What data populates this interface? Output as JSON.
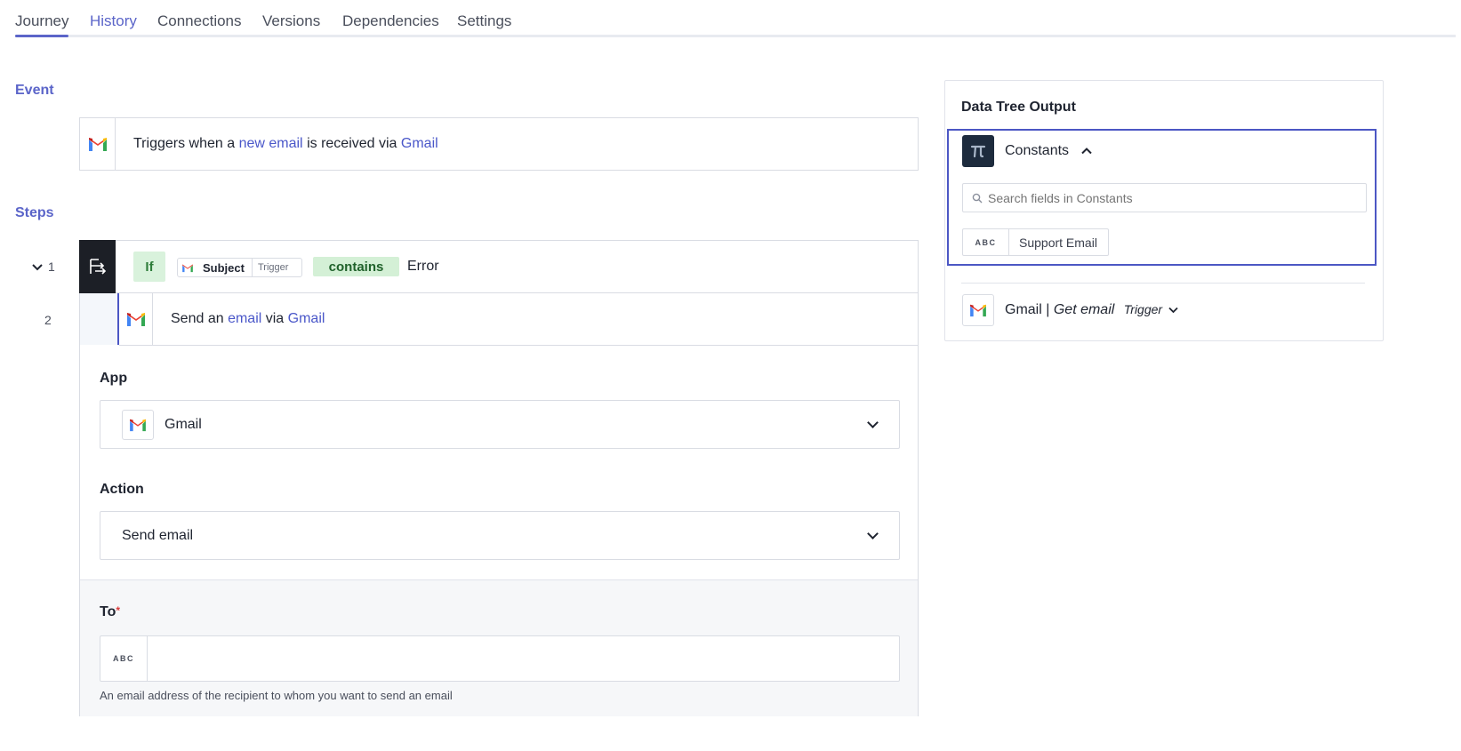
{
  "tabs": [
    {
      "label": "Journey"
    },
    {
      "label": "History"
    },
    {
      "label": "Connections"
    },
    {
      "label": "Versions"
    },
    {
      "label": "Dependencies"
    },
    {
      "label": "Settings"
    }
  ],
  "event": {
    "section_label": "Event",
    "prefix": "Triggers when a",
    "link1": "new email",
    "middle": "is received via",
    "link2": "Gmail"
  },
  "steps": {
    "section_label": "Steps",
    "step1": {
      "number": "1",
      "if_label": "If",
      "field_label": "Subject",
      "field_tag": "Trigger",
      "operator": "contains",
      "value": "Error"
    },
    "step2": {
      "number": "2",
      "prefix": "Send an",
      "link1": "email",
      "middle": "via",
      "link2": "Gmail"
    }
  },
  "form": {
    "app_label": "App",
    "app_value": "Gmail",
    "action_label": "Action",
    "action_value": "Send email",
    "to_label": "To",
    "to_required": "*",
    "to_type": "ABC",
    "to_value": "",
    "to_help": "An email address of the recipient to whom you want to send an email"
  },
  "data_tree": {
    "title": "Data Tree Output",
    "constants": {
      "label": "Constants",
      "search_placeholder": "Search fields in Constants",
      "items": [
        {
          "type": "ABC",
          "label": "Support Email"
        }
      ]
    },
    "gmail": {
      "app": "Gmail",
      "separator": "|",
      "action": "Get email",
      "tag": "Trigger"
    }
  },
  "colors": {
    "accent": "#5b65c9",
    "link": "#4a57c9",
    "if_bg": "#d9f2dc",
    "selected_border": "#4c57c4",
    "step_icon_bg": "#1c1f26"
  }
}
